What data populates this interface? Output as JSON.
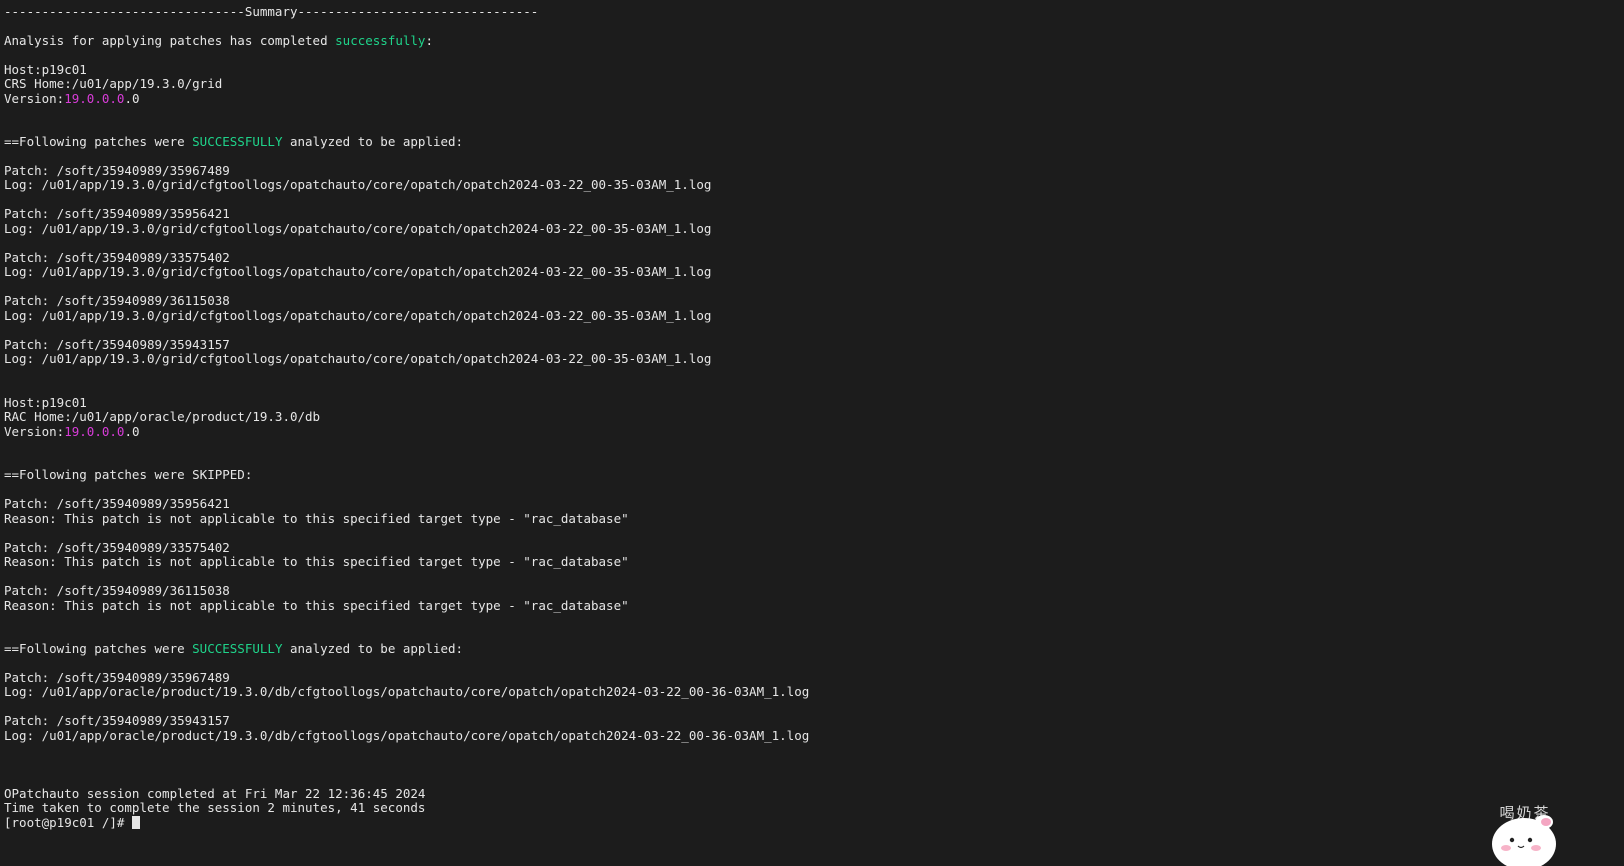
{
  "colors": {
    "background": "#1c1c1c",
    "foreground": "#e6e6e6",
    "success_green": "#1fd38a",
    "version_magenta": "#d83cd8"
  },
  "terminal": {
    "lines": {
      "l1": "--------------------------------Summary--------------------------------",
      "l2a": "Analysis for applying patches has completed ",
      "l2b": "successfully",
      "l2c": ":",
      "l3": "Host:p19c01",
      "l4": "CRS Home:/u01/app/19.3.0/grid",
      "l5a": "Version:",
      "l5b": "19.0.0.0",
      "l5c": ".0",
      "l6a": "==Following patches were ",
      "l6b": "SUCCESSFULLY",
      "l6c": " analyzed to be applied:",
      "l7": "Patch: /soft/35940989/35967489",
      "l8": "Log: /u01/app/19.3.0/grid/cfgtoollogs/opatchauto/core/opatch/opatch2024-03-22_00-35-03AM_1.log",
      "l9": "Patch: /soft/35940989/35956421",
      "l10": "Log: /u01/app/19.3.0/grid/cfgtoollogs/opatchauto/core/opatch/opatch2024-03-22_00-35-03AM_1.log",
      "l11": "Patch: /soft/35940989/33575402",
      "l12": "Log: /u01/app/19.3.0/grid/cfgtoollogs/opatchauto/core/opatch/opatch2024-03-22_00-35-03AM_1.log",
      "l13": "Patch: /soft/35940989/36115038",
      "l14": "Log: /u01/app/19.3.0/grid/cfgtoollogs/opatchauto/core/opatch/opatch2024-03-22_00-35-03AM_1.log",
      "l15": "Patch: /soft/35940989/35943157",
      "l16": "Log: /u01/app/19.3.0/grid/cfgtoollogs/opatchauto/core/opatch/opatch2024-03-22_00-35-03AM_1.log",
      "l17": "Host:p19c01",
      "l18": "RAC Home:/u01/app/oracle/product/19.3.0/db",
      "l19a": "Version:",
      "l19b": "19.0.0.0",
      "l19c": ".0",
      "l20": "==Following patches were SKIPPED:",
      "l21": "Patch: /soft/35940989/35956421",
      "l22": "Reason: This patch is not applicable to this specified target type - \"rac_database\"",
      "l23": "Patch: /soft/35940989/33575402",
      "l24": "Reason: This patch is not applicable to this specified target type - \"rac_database\"",
      "l25": "Patch: /soft/35940989/36115038",
      "l26": "Reason: This patch is not applicable to this specified target type - \"rac_database\"",
      "l27a": "==Following patches were ",
      "l27b": "SUCCESSFULLY",
      "l27c": " analyzed to be applied:",
      "l28": "Patch: /soft/35940989/35967489",
      "l29": "Log: /u01/app/oracle/product/19.3.0/db/cfgtoollogs/opatchauto/core/opatch/opatch2024-03-22_00-36-03AM_1.log",
      "l30": "Patch: /soft/35940989/35943157",
      "l31": "Log: /u01/app/oracle/product/19.3.0/db/cfgtoollogs/opatchauto/core/opatch/opatch2024-03-22_00-36-03AM_1.log",
      "l32": "OPatchauto session completed at Fri Mar 22 12:36:45 2024",
      "l33": "Time taken to complete the session 2 minutes, 41 seconds",
      "prompt": "[root@p19c01 /]# "
    }
  },
  "mascot": {
    "text": "喝奶茶",
    "icon": "cartoon-bunny-icon"
  }
}
